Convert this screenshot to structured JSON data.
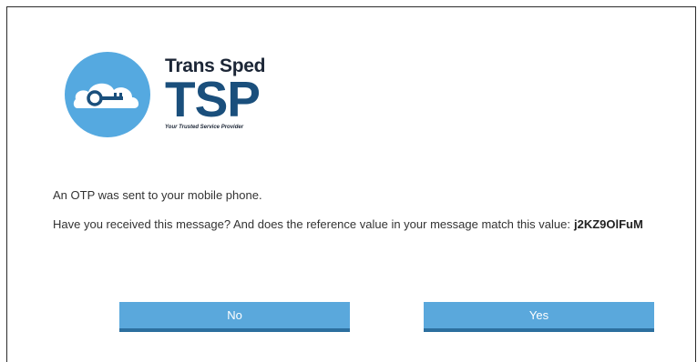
{
  "logo": {
    "brand_name": "Trans Sped",
    "abbreviation": "TSP",
    "tagline": "Your Trusted Service Provider",
    "icon": "key-cloud-icon",
    "colors": {
      "circle": "#55a9e0",
      "abbreviation": "#1a4f7c",
      "brand_name": "#1c2636"
    }
  },
  "dialog": {
    "otp_sent_text": "An OTP was sent to your mobile phone.",
    "question_text": "Have you received this message? And does the reference value in your message match this value:",
    "reference_value": "j2KZ9OlFuM"
  },
  "buttons": {
    "no_label": "No",
    "yes_label": "Yes",
    "color": "#5aa8dc",
    "border_color": "#2c6f9f"
  }
}
